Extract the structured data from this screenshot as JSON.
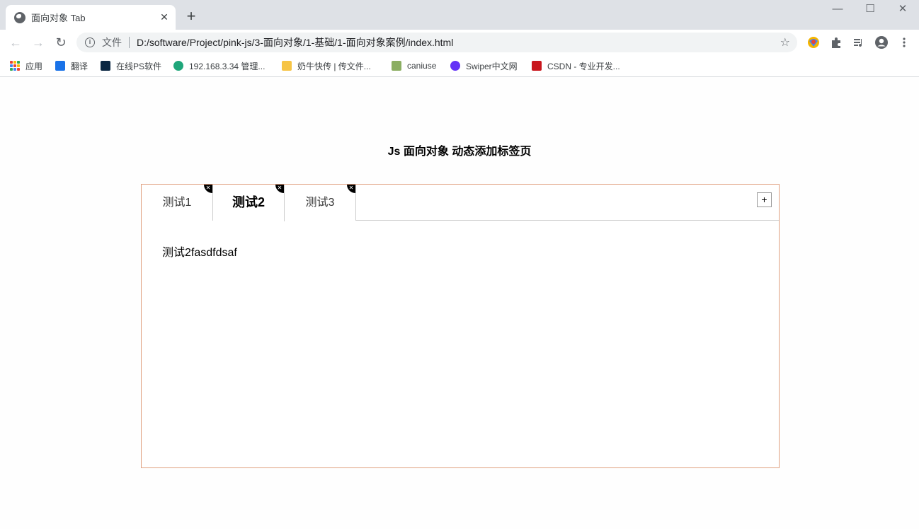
{
  "browser": {
    "tab_title": "面向对象 Tab",
    "tab_close": "✕",
    "new_tab": "+",
    "window_controls": {
      "minimize": "—",
      "maximize": "☐",
      "close": "✕"
    },
    "nav": {
      "back": "←",
      "forward": "→",
      "reload": "↻"
    },
    "address": {
      "info_icon": "i",
      "scheme_label": "文件",
      "url": "D:/software/Project/pink-js/3-面向对象/1-基础/1-面向对象案例/index.html",
      "star": "☆"
    },
    "bookmarks": [
      {
        "label": "应用"
      },
      {
        "label": "翻译",
        "color": "#1a73e8"
      },
      {
        "label": "在线PS软件",
        "color": "#0b2742"
      },
      {
        "label": "192.168.3.34 管理...",
        "color": "#1fa67a"
      },
      {
        "label": "奶牛快传 | 传文件...",
        "color": "#f6c445"
      },
      {
        "label": "caniuse",
        "color": "#8bae62"
      },
      {
        "label": "Swiper中文网",
        "color": "#6332f6"
      },
      {
        "label": "CSDN - 专业开发...",
        "color": "#c9161d"
      }
    ]
  },
  "page": {
    "heading": "Js 面向对象 动态添加标签页",
    "tabs": [
      {
        "label": "测试1",
        "active": false,
        "close": "✕"
      },
      {
        "label": "测试2",
        "active": true,
        "close": "✕"
      },
      {
        "label": "测试3",
        "active": false,
        "close": "✕"
      }
    ],
    "add_button": "+",
    "active_panel_text": "测试2fasdfdsaf",
    "accent_color": "#e0a080"
  }
}
